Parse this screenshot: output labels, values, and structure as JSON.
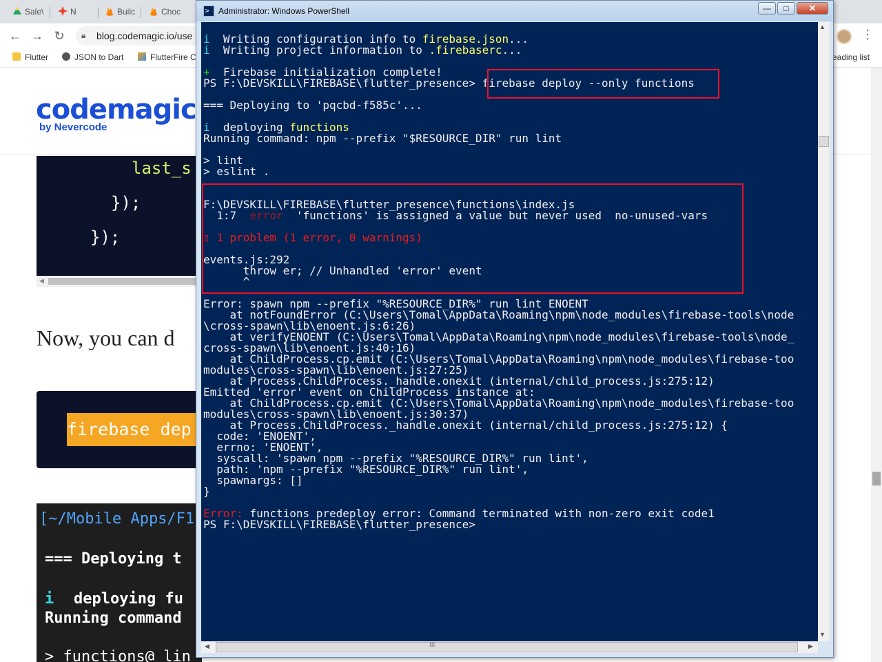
{
  "browser": {
    "tabs": [
      {
        "label": "Sale\\",
        "icon": "google-drive-icon",
        "color": "#1fa463"
      },
      {
        "label": "N",
        "icon": "codemagic-icon",
        "color": "#e8442e"
      },
      {
        "label": "Builc",
        "icon": "firebase-icon",
        "color": "#f5a623"
      },
      {
        "label": "Choc",
        "icon": "firebase-icon",
        "color": "#f5a623"
      }
    ],
    "url": "blog.codemagic.io/use",
    "bookmarks": [
      {
        "label": "Flutter",
        "icon": "folder-icon"
      },
      {
        "label": "JSON to Dart",
        "icon": "globe-icon"
      },
      {
        "label": "FlutterFire C",
        "icon": "flutterfire-icon"
      }
    ],
    "reading_list": "eading list",
    "logo_text": "codemagic",
    "logo_sub": "by Nevercode",
    "code_block_1": [
      "last_s",
      "});",
      "});"
    ],
    "body_text": "Now, you can d",
    "code_block_2": "firebase dep",
    "terminal_block": {
      "prompt": "[~/Mobile Apps/F1",
      "deploying": "=== Deploying t",
      "info_i": "i",
      "info_text": "deploying fu",
      "running": "Running command",
      "lint": "> functions@ lin"
    }
  },
  "powershell": {
    "title": "Administrator: Windows PowerShell",
    "buttons": {
      "minimize": "—",
      "maximize": "□",
      "close": "✕"
    },
    "highlight_color": "#e8122a",
    "console": {
      "l1_i": "i",
      "l1_text": "  Writing configuration info to ",
      "l1_file": "firebase.json",
      "l1_tail": "...",
      "l2_i": "i",
      "l2_text": "  Writing project information to ",
      "l2_file": ".firebaserc",
      "l2_tail": "...",
      "l3_plus": "+",
      "l3_text": "  Firebase initialization complete!",
      "l4_prompt": "PS F:\\DEVSKILL\\FIREBASE\\flutter_presence>",
      "l4_cmd": "firebase deploy --only functions",
      "l5": "=== Deploying to 'pqcbd-f585c'...",
      "l6_i": "i",
      "l6_text": "  deploying ",
      "l6_word": "functions",
      "l7": "Running command: npm --prefix \"$RESOURCE_DIR\" run lint",
      "l8": "> lint",
      "l9": "> eslint .",
      "l10": "F:\\DEVSKILL\\FIREBASE\\flutter_presence\\functions\\index.js",
      "l11_pos": "  1:7  ",
      "l11_err": "error",
      "l11_text": "  'functions' is assigned a value but never used  no-unused-vars",
      "l12": "▯ 1 problem (1 error, 0 warnings)",
      "l13": "events.js:292",
      "l14": "      throw er; // Unhandled 'error' event",
      "l15": "      ^",
      "l16": "Error: spawn npm --prefix \"%RESOURCE_DIR%\" run lint ENOENT",
      "l17": "    at notFoundError (C:\\Users\\Tomal\\AppData\\Roaming\\npm\\node_modules\\firebase-tools\\node",
      "l18": "\\cross-spawn\\lib\\enoent.js:6:26)",
      "l19": "    at verifyENOENT (C:\\Users\\Tomal\\AppData\\Roaming\\npm\\node_modules\\firebase-tools\\node_",
      "l20": "cross-spawn\\lib\\enoent.js:40:16)",
      "l21": "    at ChildProcess.cp.emit (C:\\Users\\Tomal\\AppData\\Roaming\\npm\\node_modules\\firebase-too",
      "l22": "modules\\cross-spawn\\lib\\enoent.js:27:25)",
      "l23": "    at Process.ChildProcess._handle.onexit (internal/child_process.js:275:12)",
      "l24": "Emitted 'error' event on ChildProcess instance at:",
      "l25": "    at ChildProcess.cp.emit (C:\\Users\\Tomal\\AppData\\Roaming\\npm\\node_modules\\firebase-too",
      "l26": "modules\\cross-spawn\\lib\\enoent.js:30:37)",
      "l27": "    at Process.ChildProcess._handle.onexit (internal/child_process.js:275:12) {",
      "l28": "  code: 'ENOENT',",
      "l29": "  errno: 'ENOENT',",
      "l30": "  syscall: 'spawn npm --prefix \"%RESOURCE_DIR%\" run lint',",
      "l31": "  path: 'npm --prefix \"%RESOURCE_DIR%\" run lint',",
      "l32": "  spawnargs: []",
      "l33": "}",
      "l34_err": "Error:",
      "l34_text": " functions predeploy error: Command terminated with non-zero exit code1",
      "l35": "PS F:\\DEVSKILL\\FIREBASE\\flutter_presence>"
    },
    "hscroll_grip": "III"
  }
}
